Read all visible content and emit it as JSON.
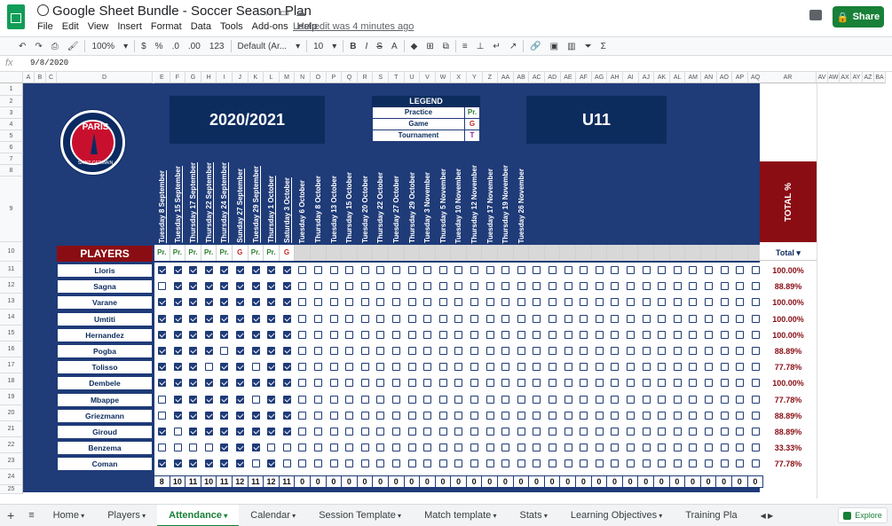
{
  "app": {
    "title": "Google Sheet Bundle - Soccer Season Plan",
    "last_edit": "Last edit was 4 minutes ago",
    "share_label": "Share"
  },
  "menu": [
    "File",
    "Edit",
    "View",
    "Insert",
    "Format",
    "Data",
    "Tools",
    "Add-ons",
    "Help"
  ],
  "toolbar": {
    "zoom": "100%",
    "currency": "$",
    "percent": "%",
    "dec_less": ".0",
    "dec_more": ".00",
    "format_123": "123",
    "font": "Default (Ar...",
    "font_size": "10",
    "bold": "B",
    "italic": "I",
    "strike": "S",
    "text_color": "A"
  },
  "formula_bar": {
    "fx": "fx",
    "value": "9/8/2020"
  },
  "sheet": {
    "season": "2020/2021",
    "team": "U11",
    "crest_name": "PARIS",
    "crest_sub": "SAINT-GERMAIN",
    "legend": {
      "title": "LEGEND",
      "items": [
        {
          "label": "Practice",
          "code": "Pr.",
          "color": "#2e7d32"
        },
        {
          "label": "Game",
          "code": "G",
          "color": "#c62828"
        },
        {
          "label": "Tournament",
          "code": "T",
          "color": "#8e24aa"
        }
      ]
    },
    "players_header": "PLAYERS",
    "total_pct_header": "TOTAL %",
    "total_label": "Total",
    "dates": [
      "Tuesday 8 September",
      "Tuesday 15 September",
      "Thursday 17 September",
      "Thursday 22 September",
      "Thursday 24 September",
      "Sunday 27 September",
      "Tuesday 29 September",
      "Thursday 1 October",
      "Saturday 3 October",
      "Tuesday 6 October",
      "Thursday 8 October",
      "Tuesday 13 October",
      "Thursday 15 October",
      "Tuesday 20 October",
      "Thursday 22 October",
      "Tuesday 27 October",
      "Thursday 29 October",
      "Tuesday 3 November",
      "Thursday 5 November",
      "Tuesday 10 November",
      "Thursday 12 November",
      "Tuesday 17 November",
      "Thursday 19 November",
      "Tuesday 26 November"
    ],
    "types": [
      "Pr.",
      "Pr.",
      "Pr.",
      "Pr.",
      "Pr.",
      "G",
      "Pr.",
      "Pr.",
      "G"
    ],
    "players": [
      {
        "name": "Lloris",
        "att": [
          1,
          1,
          1,
          1,
          1,
          1,
          1,
          1,
          1
        ],
        "pct": "100.00%"
      },
      {
        "name": "Sagna",
        "att": [
          0,
          1,
          1,
          1,
          1,
          1,
          1,
          1,
          1
        ],
        "pct": "88.89%"
      },
      {
        "name": "Varane",
        "att": [
          1,
          1,
          1,
          1,
          1,
          1,
          1,
          1,
          1
        ],
        "pct": "100.00%"
      },
      {
        "name": "Umtiti",
        "att": [
          1,
          1,
          1,
          1,
          1,
          1,
          1,
          1,
          1
        ],
        "pct": "100.00%"
      },
      {
        "name": "Hernandez",
        "att": [
          1,
          1,
          1,
          1,
          1,
          1,
          1,
          1,
          1
        ],
        "pct": "100.00%"
      },
      {
        "name": "Pogba",
        "att": [
          1,
          1,
          1,
          1,
          0,
          1,
          1,
          1,
          1
        ],
        "pct": "88.89%"
      },
      {
        "name": "Tolisso",
        "att": [
          1,
          1,
          1,
          0,
          1,
          1,
          0,
          1,
          1
        ],
        "pct": "77.78%"
      },
      {
        "name": "Dembele",
        "att": [
          1,
          1,
          1,
          1,
          1,
          1,
          1,
          1,
          1
        ],
        "pct": "100.00%"
      },
      {
        "name": "Mbappe",
        "att": [
          0,
          1,
          1,
          1,
          1,
          1,
          0,
          1,
          1
        ],
        "pct": "77.78%"
      },
      {
        "name": "Griezmann",
        "att": [
          0,
          1,
          1,
          1,
          1,
          1,
          1,
          1,
          1
        ],
        "pct": "88.89%"
      },
      {
        "name": "Giroud",
        "att": [
          1,
          0,
          1,
          1,
          1,
          1,
          1,
          1,
          1
        ],
        "pct": "88.89%"
      },
      {
        "name": "Benzema",
        "att": [
          0,
          0,
          0,
          0,
          1,
          1,
          1,
          0,
          0
        ],
        "pct": "33.33%"
      },
      {
        "name": "Coman",
        "att": [
          1,
          1,
          1,
          1,
          1,
          1,
          0,
          1,
          0
        ],
        "pct": "77.78%"
      }
    ],
    "counts": [
      "8",
      "10",
      "11",
      "10",
      "11",
      "12",
      "11",
      "12",
      "11",
      "0",
      "0",
      "0",
      "0",
      "0",
      "0",
      "0",
      "0",
      "0",
      "0",
      "0",
      "0",
      "0",
      "0",
      "0",
      "0",
      "0",
      "0",
      "0",
      "0",
      "0",
      "0",
      "0",
      "0",
      "0",
      "0",
      "0",
      "0",
      "0",
      "0"
    ],
    "columns": [
      "A",
      "B",
      "C",
      "D",
      "E",
      "F",
      "G",
      "H",
      "I",
      "J",
      "K",
      "L",
      "M",
      "N",
      "O",
      "P",
      "Q",
      "R",
      "S",
      "T",
      "U",
      "V",
      "W",
      "X",
      "Y",
      "Z",
      "AA",
      "AB",
      "AC",
      "AD",
      "AE",
      "AF",
      "AG",
      "AH",
      "AI",
      "AJ",
      "AK",
      "AL",
      "AM",
      "AN",
      "AO",
      "AP",
      "AQ",
      "AR",
      "AV",
      "AW",
      "AX",
      "AY",
      "AZ",
      "BA"
    ],
    "rows": [
      "1",
      "2",
      "3",
      "4",
      "5",
      "6",
      "7",
      "8",
      "9",
      "10",
      "11",
      "12",
      "13",
      "14",
      "15",
      "16",
      "17",
      "18",
      "19",
      "20",
      "21",
      "22",
      "23",
      "24",
      "25"
    ]
  },
  "tabs": [
    "Home",
    "Players",
    "Attendance",
    "Calendar",
    "Session Template",
    "Match template",
    "Stats",
    "Learning Objectives",
    "Training Pla"
  ],
  "active_tab": "Attendance",
  "explore_label": "Explore"
}
